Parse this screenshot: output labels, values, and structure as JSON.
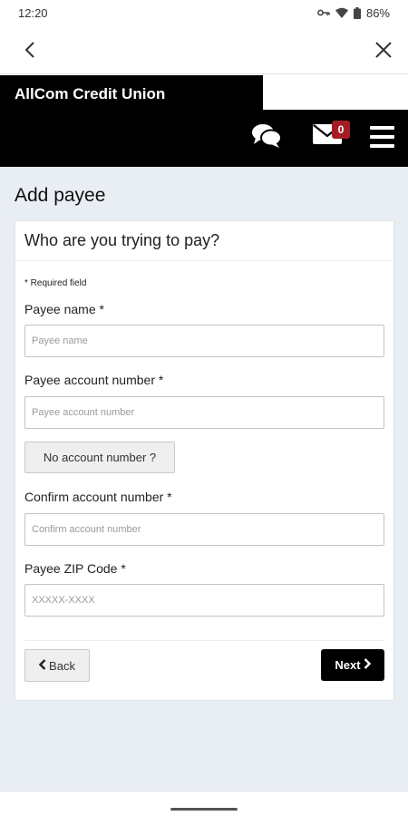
{
  "status_bar": {
    "time": "12:20",
    "battery": "86%"
  },
  "brand": {
    "name": "AllCom Credit Union"
  },
  "header": {
    "mail_count": "0"
  },
  "page": {
    "title": "Add payee",
    "card_heading": "Who are you trying to pay?",
    "required_note": "* Required field"
  },
  "form": {
    "payee_name": {
      "label": "Payee name *",
      "placeholder": "Payee name",
      "value": ""
    },
    "account_number": {
      "label": "Payee account number *",
      "placeholder": "Payee account number",
      "value": ""
    },
    "no_account_label": "No account number ?",
    "confirm_account": {
      "label": "Confirm account number *",
      "placeholder": "Confirm account number",
      "value": ""
    },
    "zip": {
      "label": "Payee ZIP Code *",
      "placeholder": "XXXXX-XXXX",
      "value": ""
    }
  },
  "buttons": {
    "back_label": "Back",
    "next_label": "Next"
  },
  "icons": [
    "wifi-icon",
    "battery-icon",
    "key-icon",
    "back-arrow-icon",
    "close-icon",
    "chat-icon",
    "mail-icon",
    "menu-icon",
    "chevron-left-icon",
    "chevron-right-icon"
  ],
  "colors": {
    "header": "#000000",
    "content_bg": "#e9edf4",
    "badge": "#a51d24",
    "next_button": "#000000"
  }
}
